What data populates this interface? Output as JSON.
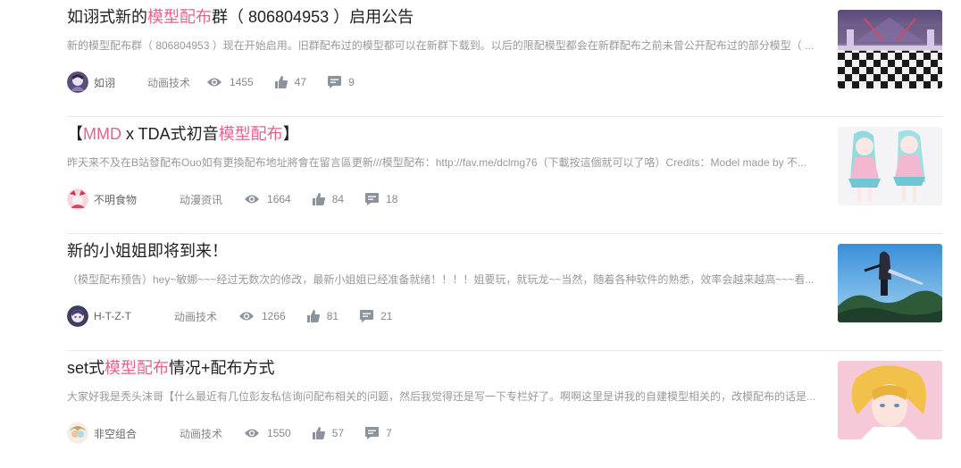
{
  "articles": [
    {
      "title_pre": "如诩式新的",
      "title_hl": "模型配布",
      "title_post": "群（ 806804953 ）启用公告",
      "desc": "新的模型配布群（ 806804953 ）现在开始启用。旧群配布过的模型都可以在新群下载到。以后的限配模型都会在新群配布之前未曾公开配布过的部分模型（ ...",
      "author": "如诩",
      "category": "动画技术",
      "views": "1455",
      "likes": "47",
      "comments": "9"
    },
    {
      "title_pre": "【",
      "title_hl": "MMD",
      "title_mid": " x TDA式初音",
      "title_hl2": "模型配布",
      "title_post": "】",
      "desc": "昨天来不及在B站發配布Ouo如有更換配布地址將會在留言區更新///模型配布：http://fav.me/dclmg76（下載按這個就可以了咯）Credits：Model made by 不...",
      "author": "不明食物",
      "category": "动漫资讯",
      "views": "1664",
      "likes": "84",
      "comments": "18"
    },
    {
      "title_pre": "新的小姐姐即将到来！",
      "desc": "（模型配布预告）hey~敏娜~~~经过无数次的修改，最新小姐姐已经准备就绪！！！！姐要玩，就玩龙~~当然，随着各种软件的熟悉，效率会越来越高~~~看...",
      "author": "H-T-Z-T",
      "category": "动画技术",
      "views": "1266",
      "likes": "81",
      "comments": "21"
    },
    {
      "title_pre": "set式",
      "title_hl": "模型配布",
      "title_post": "情况+配布方式",
      "desc": "大家好我是秃头沫哥【什么最近有几位彭友私信询问配布相关的问题，然后我觉得还是写一下专栏好了。啊啊这里是讲我的自建模型相关的，改模配布的话是...",
      "author": "非空组合",
      "category": "动画技术",
      "views": "1550",
      "likes": "57",
      "comments": "7"
    }
  ],
  "colors": {
    "highlight": "#e5628f",
    "title": "#212121",
    "meta": "#999999"
  },
  "icons": [
    "eye-icon",
    "thumbs-up-icon",
    "comment-icon"
  ]
}
